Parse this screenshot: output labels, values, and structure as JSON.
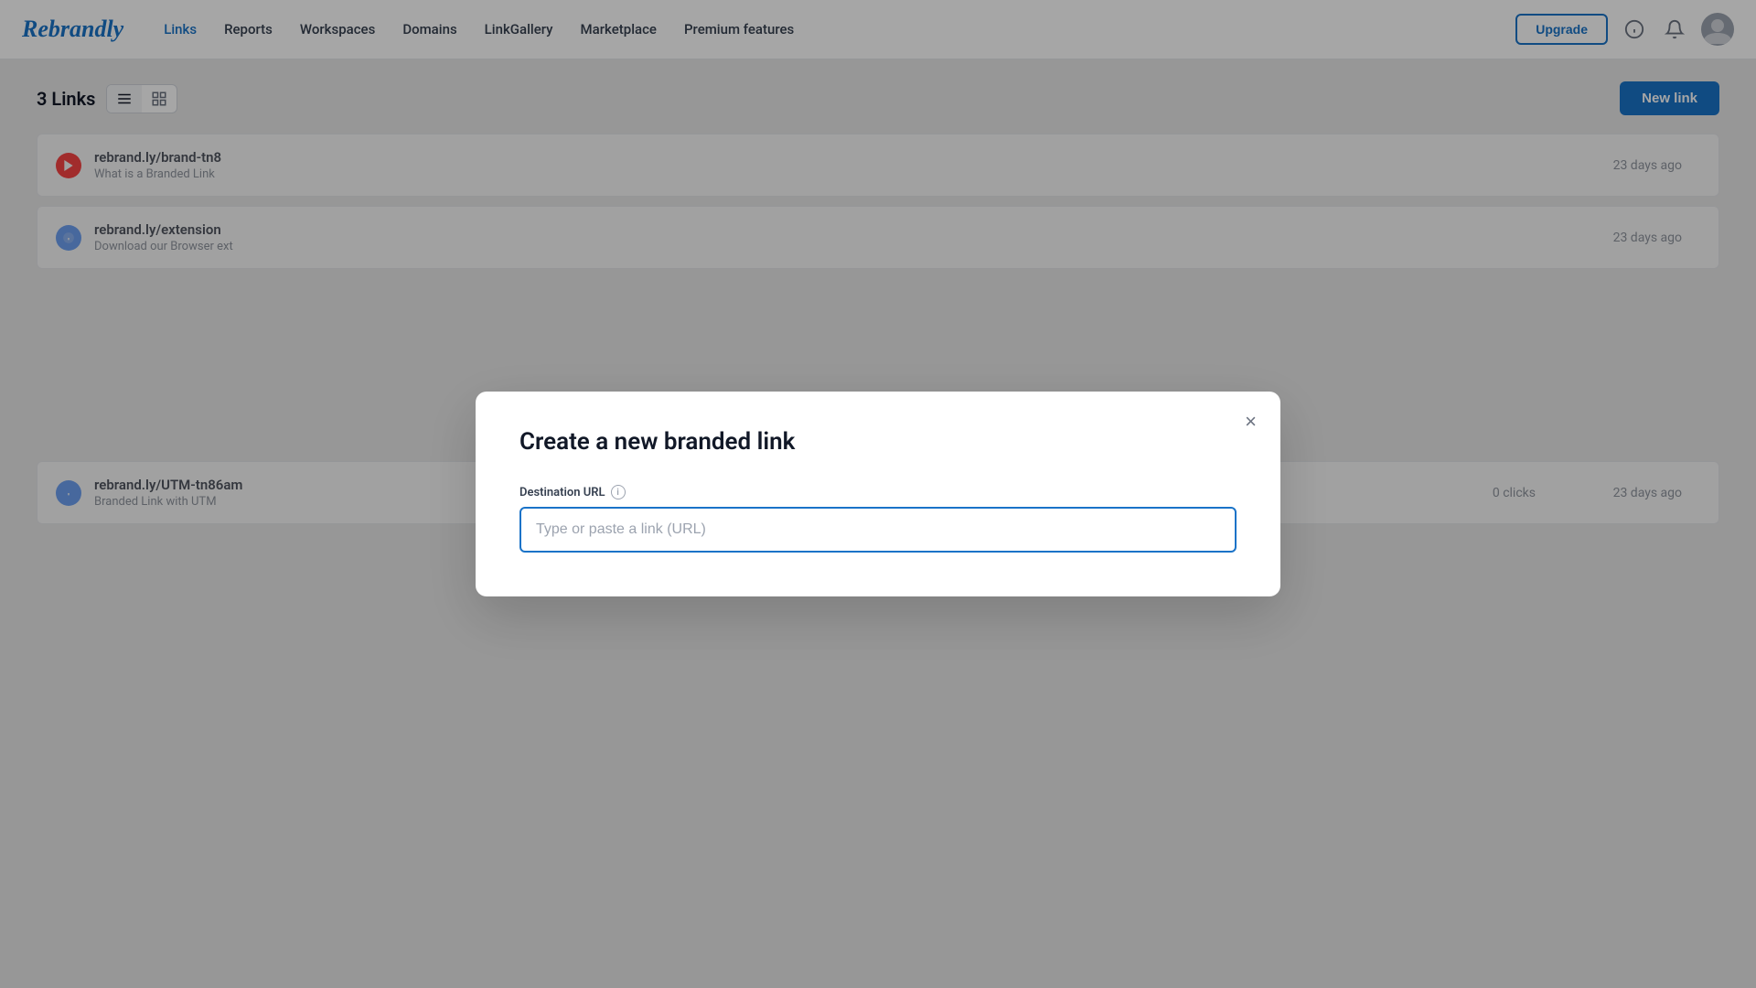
{
  "navbar": {
    "logo": "Rebrandly",
    "links": [
      {
        "id": "links",
        "label": "Links",
        "active": true
      },
      {
        "id": "reports",
        "label": "Reports",
        "active": false
      },
      {
        "id": "workspaces",
        "label": "Workspaces",
        "active": false
      },
      {
        "id": "domains",
        "label": "Domains",
        "active": false
      },
      {
        "id": "linkgallery",
        "label": "LinkGallery",
        "active": false
      },
      {
        "id": "marketplace",
        "label": "Marketplace",
        "active": false
      },
      {
        "id": "premium",
        "label": "Premium features",
        "active": false
      }
    ],
    "upgrade_label": "Upgrade"
  },
  "content": {
    "links_count_label": "3 Links",
    "new_link_label": "New link"
  },
  "links": [
    {
      "id": "link-1",
      "icon_type": "youtube",
      "url": "rebrand.ly/brand-tn8",
      "description": "What is a Branded Link",
      "clicks": "",
      "date": "23 days ago"
    },
    {
      "id": "link-2",
      "icon_type": "info",
      "url": "rebrand.ly/extension",
      "description": "Download our Browser ext",
      "clicks": "",
      "date": "23 days ago"
    },
    {
      "id": "link-3",
      "icon_type": "info",
      "url": "rebrand.ly/UTM-tn86am",
      "description": "Branded Link with UTM",
      "clicks": "0 clicks",
      "date": "23 days ago"
    }
  ],
  "modal": {
    "title": "Create a new branded link",
    "close_label": "×",
    "field_label": "Destination URL",
    "url_placeholder": "Type or paste a link (URL)"
  },
  "icons": {
    "list_view": "☰",
    "grid_view": "⊞",
    "bell": "🔔",
    "info_circle": "ℹ"
  }
}
